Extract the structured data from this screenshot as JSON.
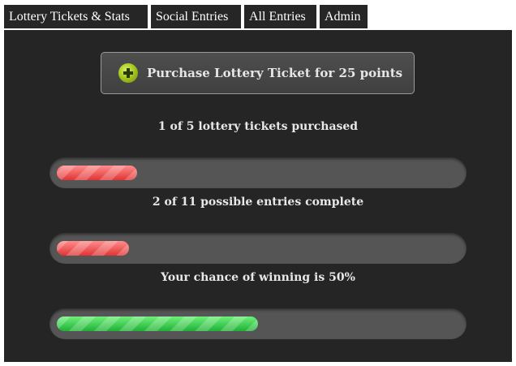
{
  "tabs": [
    {
      "label": "Lottery Tickets & Stats"
    },
    {
      "label": "Social Entries"
    },
    {
      "label": "All Entries"
    },
    {
      "label": "Admin"
    }
  ],
  "purchase": {
    "label": "Purchase Lottery Ticket for 25 points",
    "icon": "plus-circle-icon"
  },
  "stats": [
    {
      "text": "1 of 5 lottery tickets purchased",
      "progress": 0.2,
      "color": "red"
    },
    {
      "text": "2 of 11 possible entries complete",
      "progress": 0.18,
      "color": "red"
    },
    {
      "text": "Your chance of winning is 50%",
      "progress": 0.5,
      "color": "green"
    }
  ],
  "colors": {
    "panel_bg": "#252525",
    "tab_bg": "#262626",
    "progress_red": "#e84444",
    "progress_green": "#2fca45"
  }
}
